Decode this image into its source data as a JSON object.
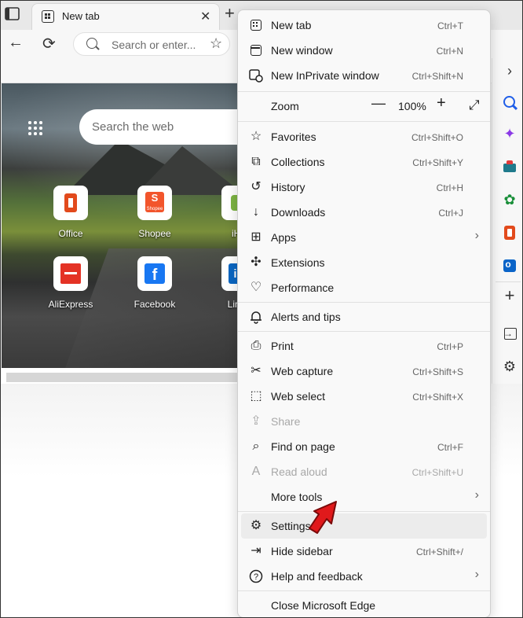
{
  "tab": {
    "title": "New tab",
    "close": "✕",
    "new_tab": "+"
  },
  "toolbar": {
    "back": "←",
    "refresh": "⟳",
    "address_placeholder": "Search or enter...",
    "favorite": "☆"
  },
  "newtab_page": {
    "search_placeholder": "Search the web",
    "tiles": [
      {
        "label": "Office"
      },
      {
        "label": "Shopee",
        "icon_text": "Shopee"
      },
      {
        "label": "iHe"
      },
      {
        "label": "AliExpress"
      },
      {
        "label": "Facebook",
        "icon_text": "f"
      },
      {
        "label": "Linke",
        "icon_text": "in"
      }
    ]
  },
  "sidebar": {
    "chevron": "›",
    "copilot": "✦",
    "games": "✿",
    "plus": "+",
    "gear": "⚙"
  },
  "menu": {
    "items": [
      {
        "label": "New tab",
        "shortcut": "Ctrl+T",
        "icon": "new-tab-icon"
      },
      {
        "label": "New window",
        "shortcut": "Ctrl+N",
        "icon": "new-window-icon"
      },
      {
        "label": "New InPrivate window",
        "shortcut": "Ctrl+Shift+N",
        "icon": "inprivate-icon"
      },
      {
        "label": "Zoom",
        "icon": "none"
      },
      {
        "label": "Favorites",
        "shortcut": "Ctrl+Shift+O",
        "icon": "favorites-icon",
        "glyph": "☆"
      },
      {
        "label": "Collections",
        "shortcut": "Ctrl+Shift+Y",
        "icon": "collections-icon",
        "glyph": "⧉"
      },
      {
        "label": "History",
        "shortcut": "Ctrl+H",
        "icon": "history-icon",
        "glyph": "↺"
      },
      {
        "label": "Downloads",
        "shortcut": "Ctrl+J",
        "icon": "downloads-icon",
        "glyph": "↓"
      },
      {
        "label": "Apps",
        "icon": "apps-icon",
        "glyph": "⊞",
        "arrow": "›"
      },
      {
        "label": "Extensions",
        "icon": "extensions-icon",
        "glyph": "✣"
      },
      {
        "label": "Performance",
        "icon": "performance-icon",
        "glyph": "♡"
      },
      {
        "label": "Alerts and tips",
        "icon": "bell-icon",
        "glyph": "🔔︎"
      },
      {
        "label": "Print",
        "shortcut": "Ctrl+P",
        "icon": "print-icon",
        "glyph": "⎙"
      },
      {
        "label": "Web capture",
        "shortcut": "Ctrl+Shift+S",
        "icon": "web-capture-icon",
        "glyph": "✂"
      },
      {
        "label": "Web select",
        "shortcut": "Ctrl+Shift+X",
        "icon": "web-select-icon",
        "glyph": "⬚"
      },
      {
        "label": "Share",
        "icon": "share-icon",
        "glyph": "⇪"
      },
      {
        "label": "Find on page",
        "shortcut": "Ctrl+F",
        "icon": "find-icon",
        "glyph": "⌕"
      },
      {
        "label": "Read aloud",
        "shortcut": "Ctrl+Shift+U",
        "icon": "read-aloud-icon",
        "glyph": "A"
      },
      {
        "label": "More tools",
        "icon": "none",
        "arrow": "›"
      },
      {
        "label": "Settings",
        "icon": "gear-icon",
        "glyph": "⚙"
      },
      {
        "label": "Hide sidebar",
        "shortcut": "Ctrl+Shift+/",
        "icon": "sidebar-icon",
        "glyph": "⇥"
      },
      {
        "label": "Help and feedback",
        "icon": "help-icon",
        "glyph": "?",
        "arrow": "›"
      },
      {
        "label": "Close Microsoft Edge",
        "icon": "none"
      }
    ],
    "zoom": {
      "minus": "—",
      "value": "100%",
      "plus": "+",
      "fullscreen": "⤢"
    }
  },
  "colors": {
    "accent_arrow": "#e0191b",
    "menu_bg": "#f9f9f9",
    "hover_bg": "#ececec"
  }
}
